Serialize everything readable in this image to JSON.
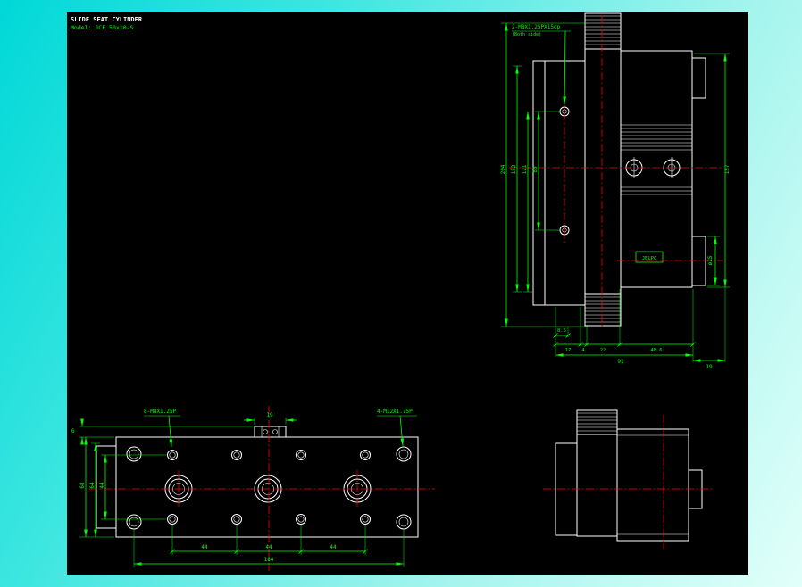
{
  "title_block": {
    "line1": "SLIDE SEAT CYLINDER",
    "line2": "Model: JCF 50x10-S"
  },
  "side_view": {
    "tap_label": "2-M8X1.25PX15dp",
    "tap_note": "(Both side)",
    "brand": "JELPC",
    "dims": {
      "d204": "204",
      "d152": "152",
      "d121": "121",
      "d80": "80",
      "d157": "157",
      "dia25": "ø25",
      "d8_5": "8.5",
      "d17": "17",
      "d4": "4",
      "d22": "22",
      "d48_6": "48.6",
      "d91": "91",
      "d19": "19"
    }
  },
  "plan_view": {
    "thread_label_m8": "8-M8X1.25P",
    "thread_label_m12": "4-M12X1.75P",
    "dims": {
      "d19": "19",
      "d6": "6",
      "d68": "68",
      "d64": "64",
      "d44_left": "44",
      "d44_1": "44",
      "d44_2": "44",
      "d44_3": "44",
      "d184": "184"
    }
  }
}
